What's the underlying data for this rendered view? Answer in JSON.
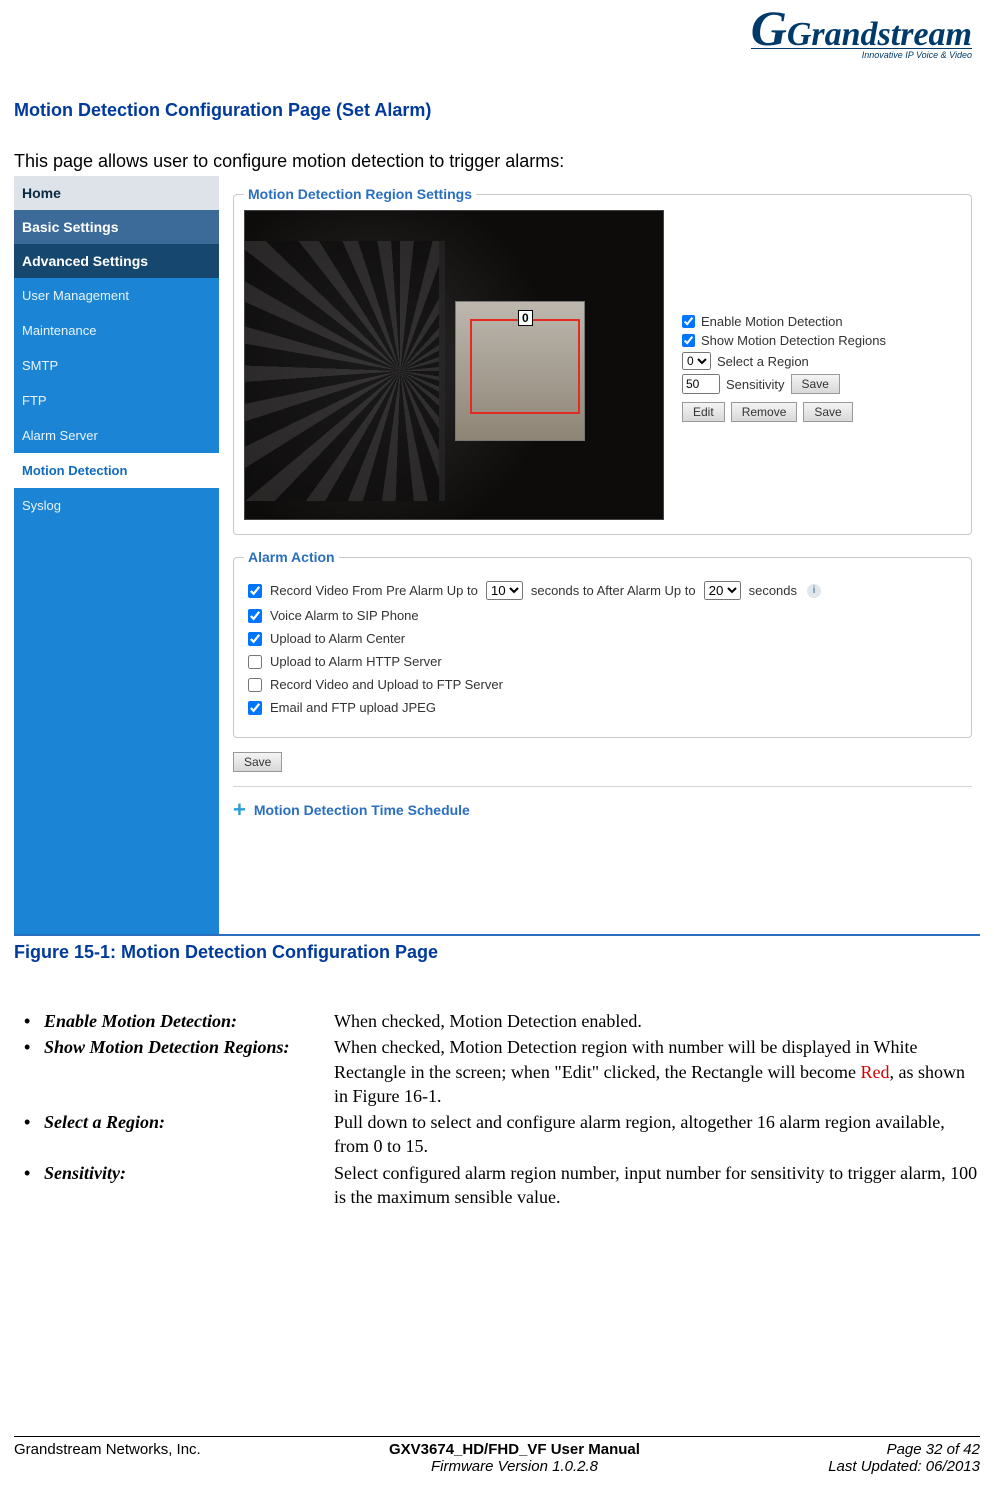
{
  "logo": {
    "brand": "Grandstream",
    "tagline": "Innovative IP Voice & Video"
  },
  "heading": "Motion Detection Configuration Page (Set Alarm)",
  "intro": "This page allows user to configure motion detection to trigger alarms:",
  "sidebar": {
    "home": "Home",
    "basic": "Basic Settings",
    "advanced": "Advanced Settings",
    "items": [
      "User Management",
      "Maintenance",
      "SMTP",
      "FTP",
      "Alarm Server",
      "Motion Detection",
      "Syslog"
    ],
    "active_index": 5
  },
  "region_settings": {
    "legend": "Motion Detection Region Settings",
    "marker": "0",
    "enable_label": "Enable Motion Detection",
    "show_label": "Show Motion Detection Regions",
    "select_value": "0",
    "select_label": "Select a Region",
    "sensitivity_value": "50",
    "sensitivity_label": "Sensitivity",
    "save_label": "Save",
    "edit_label": "Edit",
    "remove_label": "Remove",
    "save2_label": "Save"
  },
  "alarm_action": {
    "legend": "Alarm Action",
    "row1_pre": "Record Video From Pre Alarm  Up to",
    "row1_val1": "10",
    "row1_mid": "seconds  to After Alarm  Up to",
    "row1_val2": "20",
    "row1_suf": "seconds",
    "row2": "Voice Alarm to SIP Phone",
    "row3": "Upload to Alarm Center",
    "row4": "Upload to Alarm HTTP Server",
    "row5": "Record Video and Upload to FTP Server",
    "row6": "Email and FTP upload JPEG",
    "save_label": "Save"
  },
  "schedule_label": "Motion Detection Time Schedule",
  "figure_caption": "Figure 15-1:  Motion Detection Configuration Page",
  "descriptions": [
    {
      "term": "Enable Motion Detection:",
      "def_parts": [
        "When checked, Motion Detection enabled."
      ]
    },
    {
      "term": "Show Motion Detection Regions:",
      "def_parts": [
        "When checked, Motion Detection region with number will be displayed in White Rectangle in the screen; when \"Edit\" clicked, the Rectangle will become ",
        {
          "red": "Red"
        },
        ", as shown in Figure 16-1."
      ]
    },
    {
      "term": "Select a Region:",
      "def_parts": [
        "Pull down to select and configure alarm region, altogether 16 alarm region available, from 0 to 15."
      ]
    },
    {
      "term": "Sensitivity:",
      "def_parts": [
        "Select configured alarm region number, input number for sensitivity to trigger alarm, 100 is the maximum sensible value."
      ]
    }
  ],
  "footer": {
    "left": "Grandstream Networks, Inc.",
    "mid1": "GXV3674_HD/FHD_VF User Manual",
    "mid2": "Firmware Version 1.0.2.8",
    "right1": "Page 32 of 42",
    "right2": "Last Updated: 06/2013"
  }
}
